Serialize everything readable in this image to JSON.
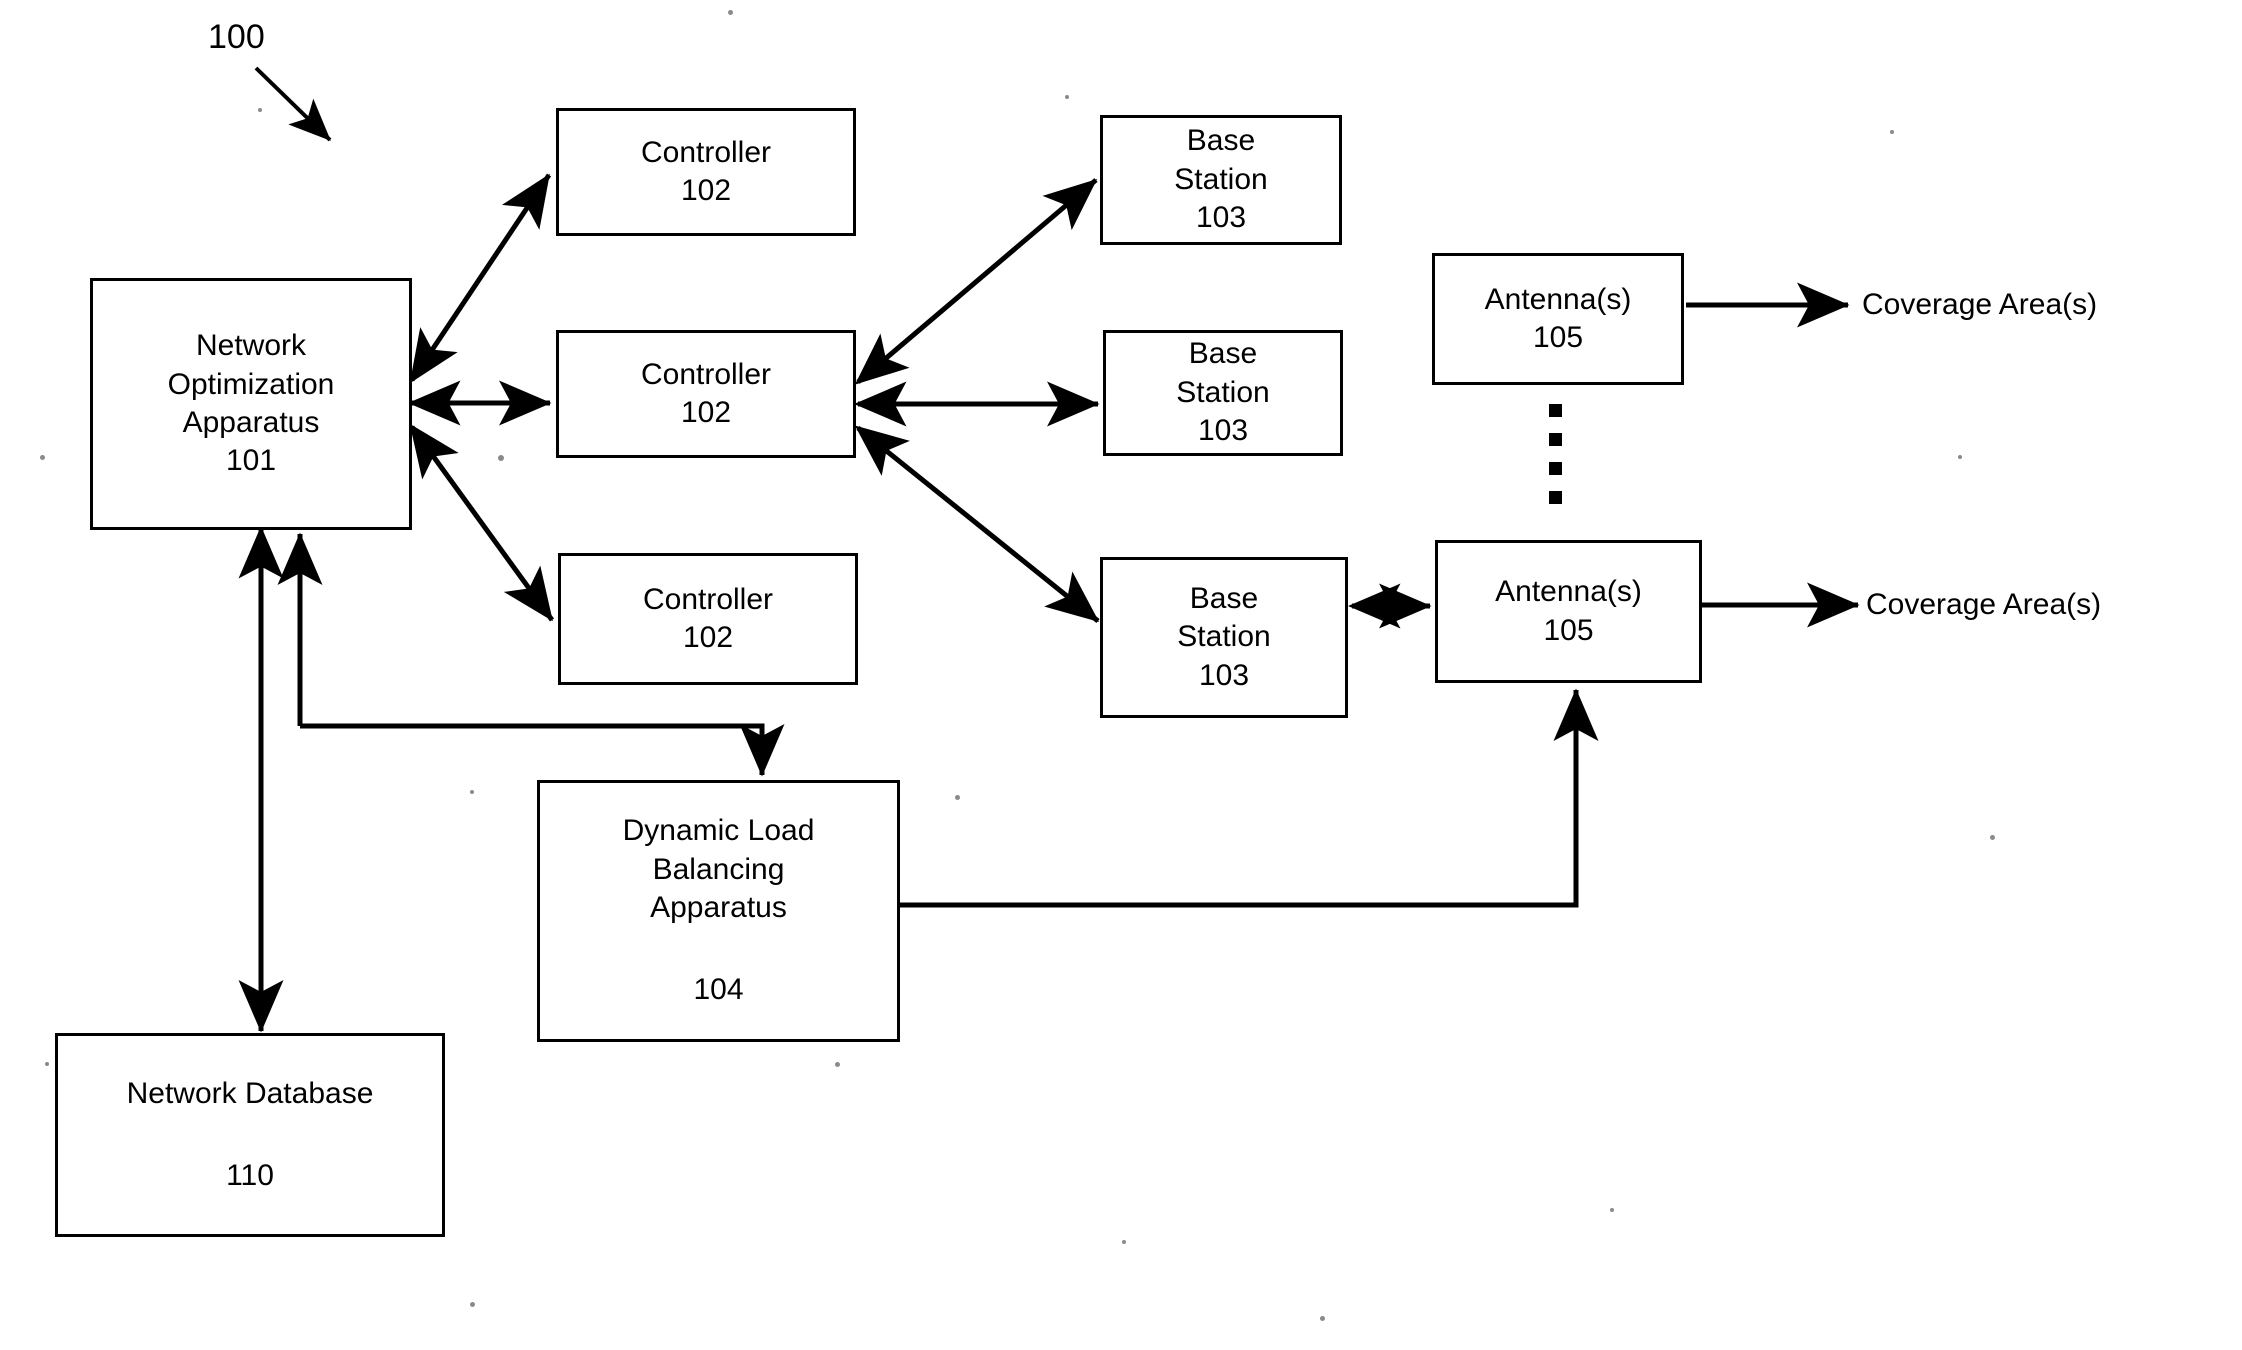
{
  "figure": {
    "number": "100",
    "title_lines": []
  },
  "nodes": {
    "network_optimization_apparatus": {
      "lines": [
        "Network",
        "Optimization",
        "Apparatus"
      ],
      "ref": "101"
    },
    "controller_1": {
      "lines": [
        "Controller"
      ],
      "ref": "102"
    },
    "controller_2": {
      "lines": [
        "Controller"
      ],
      "ref": "102"
    },
    "controller_3": {
      "lines": [
        "Controller"
      ],
      "ref": "102"
    },
    "base_station_1": {
      "lines": [
        "Base",
        "Station"
      ],
      "ref": "103"
    },
    "base_station_2": {
      "lines": [
        "Base",
        "Station"
      ],
      "ref": "103"
    },
    "base_station_3": {
      "lines": [
        "Base",
        "Station"
      ],
      "ref": "103"
    },
    "antenna_1": {
      "lines": [
        "Antenna(s)"
      ],
      "ref": "105"
    },
    "antenna_2": {
      "lines": [
        "Antenna(s)"
      ],
      "ref": "105"
    },
    "dynamic_load_balancing_apparatus": {
      "lines": [
        "Dynamic Load",
        "Balancing",
        "Apparatus"
      ],
      "ref": "104"
    },
    "network_database": {
      "lines": [
        "Network Database"
      ],
      "ref": "110"
    }
  },
  "labels": {
    "coverage_area_top": "Coverage Area(s)",
    "coverage_area_bottom": "Coverage Area(s)"
  },
  "colors": {
    "line": "#000000",
    "text": "#000000",
    "background": "#ffffff"
  }
}
